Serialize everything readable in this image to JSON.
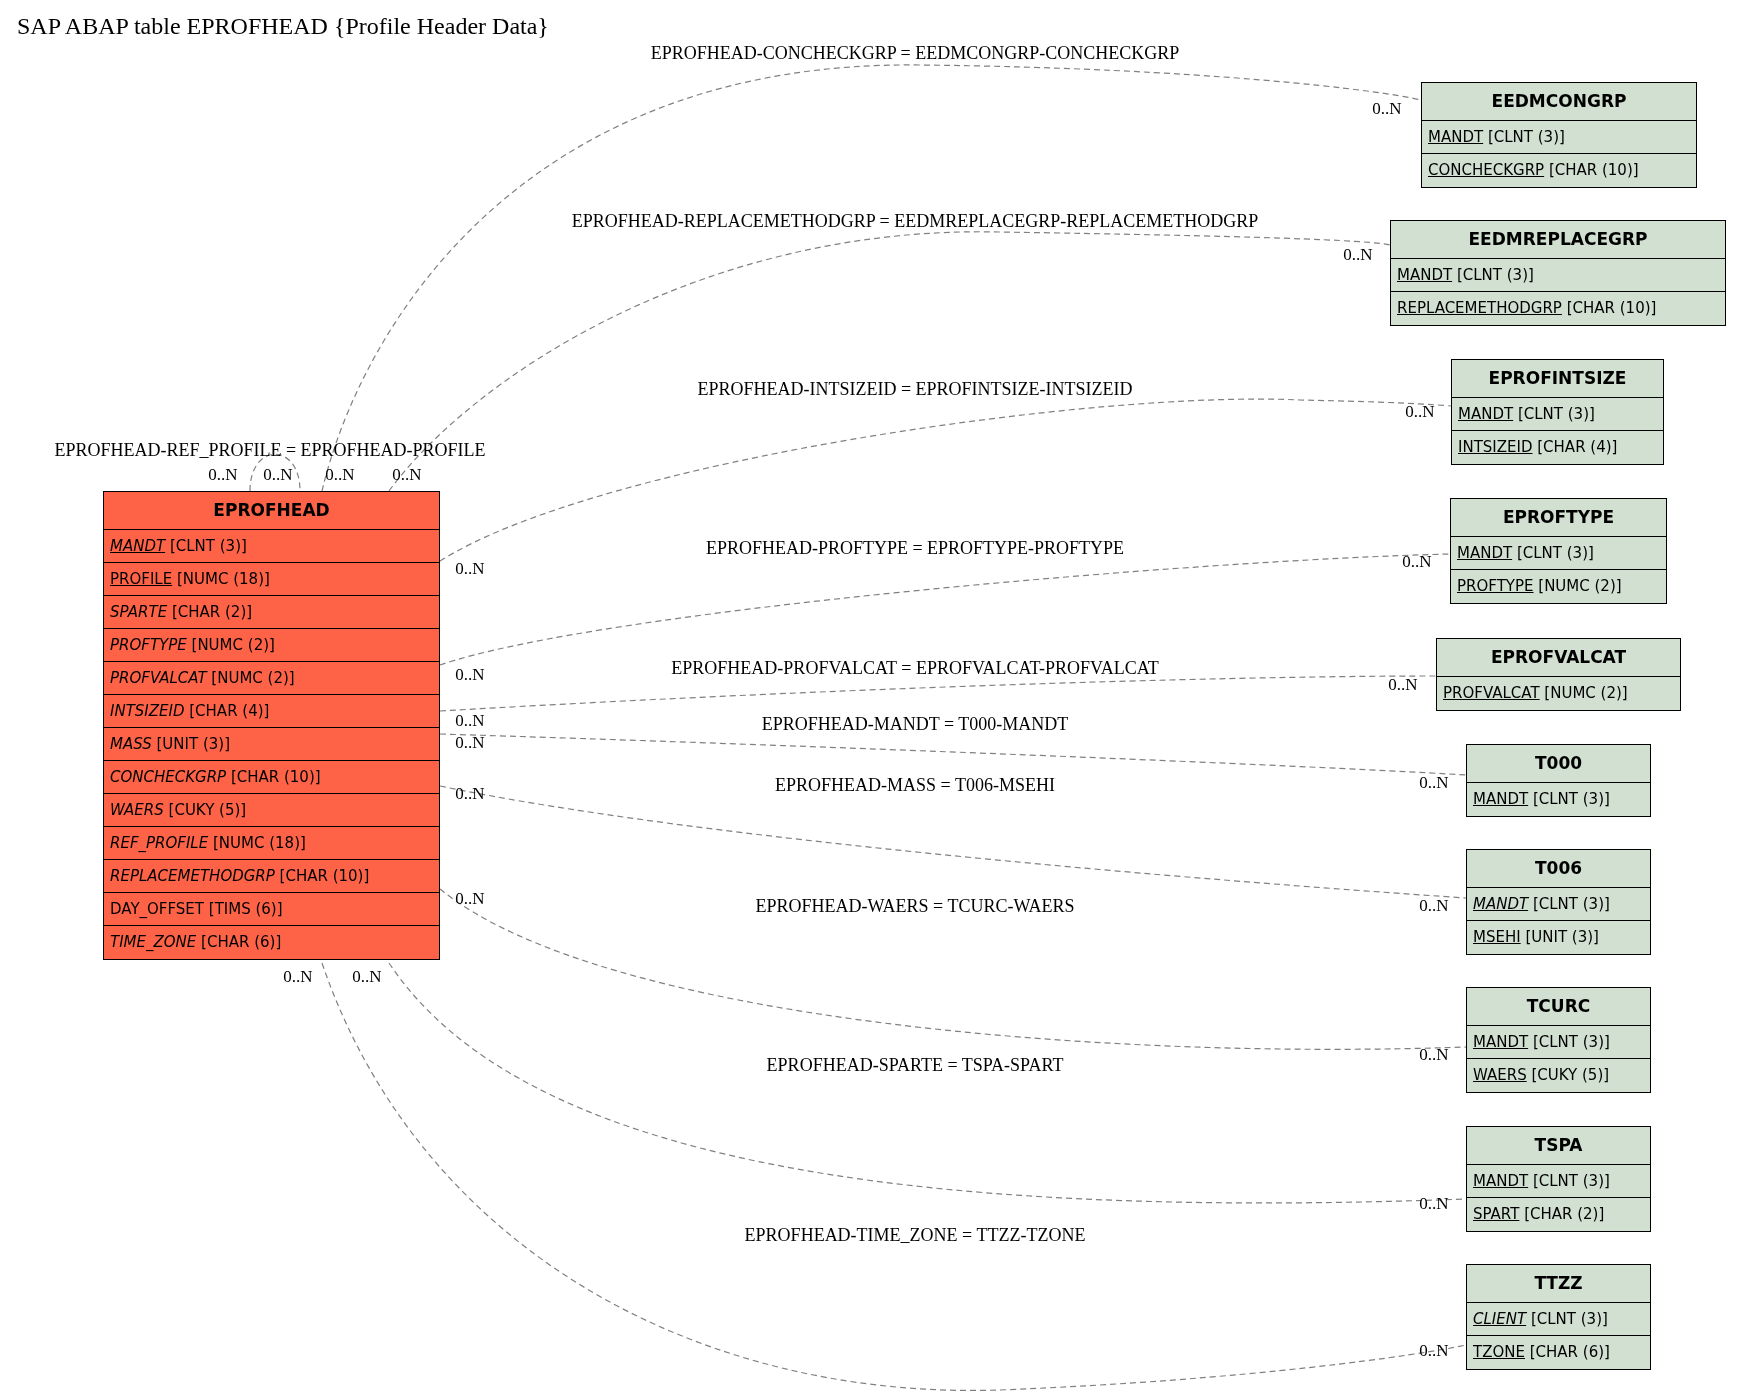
{
  "title": "SAP ABAP table EPROFHEAD {Profile Header Data}",
  "tables": [
    {
      "name": "EPROFHEAD",
      "kind": "main",
      "fields": [
        {
          "name": "MANDT",
          "type": "[CLNT (3)]",
          "key": true,
          "italic": true
        },
        {
          "name": "PROFILE",
          "type": "[NUMC (18)]",
          "key": true,
          "italic": false
        },
        {
          "name": "SPARTE",
          "type": "[CHAR (2)]",
          "key": false,
          "italic": true
        },
        {
          "name": "PROFTYPE",
          "type": "[NUMC (2)]",
          "key": false,
          "italic": true
        },
        {
          "name": "PROFVALCAT",
          "type": "[NUMC (2)]",
          "key": false,
          "italic": true
        },
        {
          "name": "INTSIZEID",
          "type": "[CHAR (4)]",
          "key": false,
          "italic": true
        },
        {
          "name": "MASS",
          "type": "[UNIT (3)]",
          "key": false,
          "italic": true
        },
        {
          "name": "CONCHECKGRP",
          "type": "[CHAR (10)]",
          "key": false,
          "italic": true
        },
        {
          "name": "WAERS",
          "type": "[CUKY (5)]",
          "key": false,
          "italic": true
        },
        {
          "name": "REF_PROFILE",
          "type": "[NUMC (18)]",
          "key": false,
          "italic": true
        },
        {
          "name": "REPLACEMETHODGRP",
          "type": "[CHAR (10)]",
          "key": false,
          "italic": true
        },
        {
          "name": "DAY_OFFSET",
          "type": "[TIMS (6)]",
          "key": false,
          "italic": false
        },
        {
          "name": "TIME_ZONE",
          "type": "[CHAR (6)]",
          "key": false,
          "italic": true
        }
      ]
    },
    {
      "name": "EEDMCONGRP",
      "kind": "related",
      "fields": [
        {
          "name": "MANDT",
          "type": "[CLNT (3)]",
          "key": true,
          "italic": false
        },
        {
          "name": "CONCHECKGRP",
          "type": "[CHAR (10)]",
          "key": true,
          "italic": false
        }
      ]
    },
    {
      "name": "EEDMREPLACEGRP",
      "kind": "related",
      "fields": [
        {
          "name": "MANDT",
          "type": "[CLNT (3)]",
          "key": true,
          "italic": false
        },
        {
          "name": "REPLACEMETHODGRP",
          "type": "[CHAR (10)]",
          "key": true,
          "italic": false
        }
      ]
    },
    {
      "name": "EPROFINTSIZE",
      "kind": "related",
      "fields": [
        {
          "name": "MANDT",
          "type": "[CLNT (3)]",
          "key": true,
          "italic": false
        },
        {
          "name": "INTSIZEID",
          "type": "[CHAR (4)]",
          "key": true,
          "italic": false
        }
      ]
    },
    {
      "name": "EPROFTYPE",
      "kind": "related",
      "fields": [
        {
          "name": "MANDT",
          "type": "[CLNT (3)]",
          "key": true,
          "italic": false
        },
        {
          "name": "PROFTYPE",
          "type": "[NUMC (2)]",
          "key": true,
          "italic": false
        }
      ]
    },
    {
      "name": "EPROFVALCAT",
      "kind": "related",
      "fields": [
        {
          "name": "PROFVALCAT",
          "type": "[NUMC (2)]",
          "key": true,
          "italic": false
        }
      ]
    },
    {
      "name": "T000",
      "kind": "related",
      "fields": [
        {
          "name": "MANDT",
          "type": "[CLNT (3)]",
          "key": true,
          "italic": false
        }
      ]
    },
    {
      "name": "T006",
      "kind": "related",
      "fields": [
        {
          "name": "MANDT",
          "type": "[CLNT (3)]",
          "key": true,
          "italic": true
        },
        {
          "name": "MSEHI",
          "type": "[UNIT (3)]",
          "key": true,
          "italic": false
        }
      ]
    },
    {
      "name": "TCURC",
      "kind": "related",
      "fields": [
        {
          "name": "MANDT",
          "type": "[CLNT (3)]",
          "key": true,
          "italic": false
        },
        {
          "name": "WAERS",
          "type": "[CUKY (5)]",
          "key": true,
          "italic": false
        }
      ]
    },
    {
      "name": "TSPA",
      "kind": "related",
      "fields": [
        {
          "name": "MANDT",
          "type": "[CLNT (3)]",
          "key": true,
          "italic": false
        },
        {
          "name": "SPART",
          "type": "[CHAR (2)]",
          "key": true,
          "italic": false
        }
      ]
    },
    {
      "name": "TTZZ",
      "kind": "related",
      "fields": [
        {
          "name": "CLIENT",
          "type": "[CLNT (3)]",
          "key": true,
          "italic": true
        },
        {
          "name": "TZONE",
          "type": "[CHAR (6)]",
          "key": true,
          "italic": false
        }
      ]
    }
  ],
  "relations": [
    {
      "label": "EPROFHEAD-CONCHECKGRP = EEDMCONGRP-CONCHECKGRP",
      "cardinalities": [
        "0..N",
        "0..N"
      ]
    },
    {
      "label": "EPROFHEAD-REPLACEMETHODGRP = EEDMREPLACEGRP-REPLACEMETHODGRP",
      "cardinalities": [
        "0..N",
        "0..N"
      ]
    },
    {
      "label": "EPROFHEAD-INTSIZEID = EPROFINTSIZE-INTSIZEID",
      "cardinalities": [
        "0..N",
        "0..N"
      ]
    },
    {
      "label": "EPROFHEAD-PROFTYPE = EPROFTYPE-PROFTYPE",
      "cardinalities": [
        "0..N",
        "0..N"
      ]
    },
    {
      "label": "EPROFHEAD-PROFVALCAT = EPROFVALCAT-PROFVALCAT",
      "cardinalities": [
        "0..N",
        "0..N"
      ]
    },
    {
      "label": "EPROFHEAD-MANDT = T000-MANDT",
      "cardinalities": [
        "0..N",
        "0..N"
      ]
    },
    {
      "label": "EPROFHEAD-MASS = T006-MSEHI",
      "cardinalities": [
        "0..N",
        "0..N"
      ]
    },
    {
      "label": "EPROFHEAD-WAERS = TCURC-WAERS",
      "cardinalities": [
        "0..N",
        "0..N"
      ]
    },
    {
      "label": "EPROFHEAD-SPARTE = TSPA-SPART",
      "cardinalities": [
        "0..N",
        "0..N"
      ]
    },
    {
      "label": "EPROFHEAD-TIME_ZONE = TTZZ-TZONE",
      "cardinalities": [
        "0..N",
        "0..N"
      ]
    },
    {
      "label": "EPROFHEAD-REF_PROFILE = EPROFHEAD-PROFILE",
      "cardinalities": [
        "0..N",
        "0..N"
      ]
    }
  ]
}
